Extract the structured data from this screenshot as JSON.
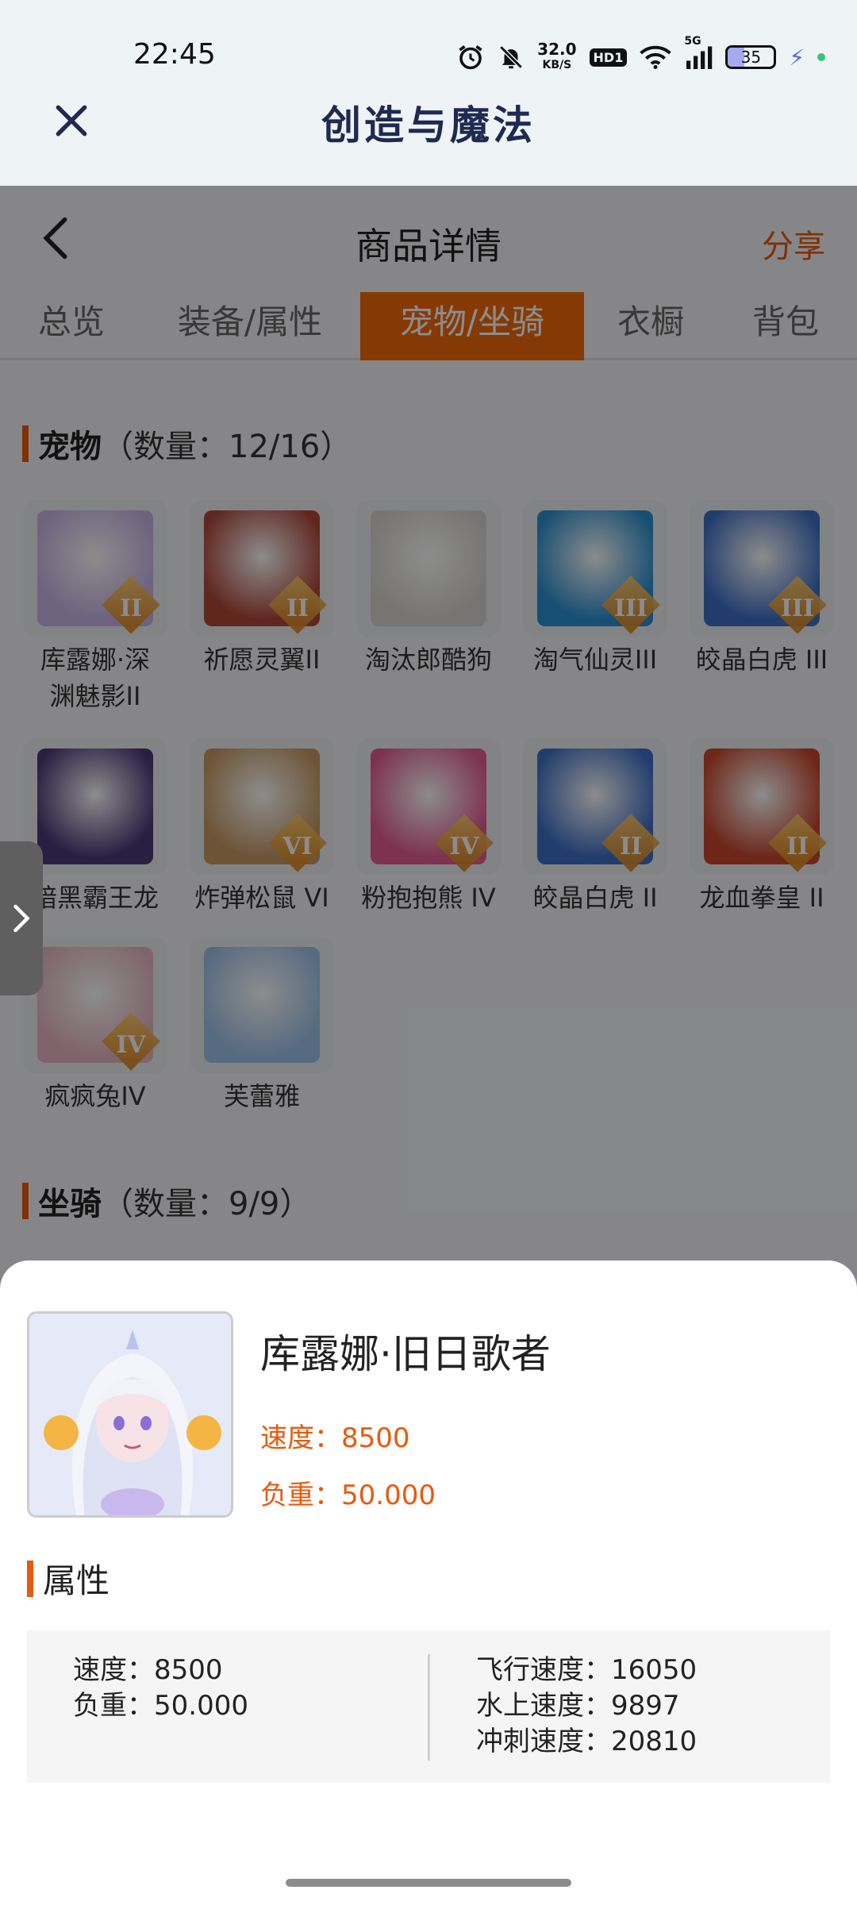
{
  "status_bar": {
    "time": "22:45",
    "net_speed_value": "32.0",
    "net_speed_unit": "KB/S",
    "hd_label": "HD1",
    "network_label": "5G",
    "battery_level": "35",
    "battery_fraction": 0.35
  },
  "app": {
    "title": "创造与魔法"
  },
  "nav": {
    "title": "商品详情",
    "share": "分享"
  },
  "tabs": [
    {
      "label": "总览",
      "active": false
    },
    {
      "label": "装备/属性",
      "active": false
    },
    {
      "label": "宠物/坐骑",
      "active": true
    },
    {
      "label": "衣橱",
      "active": false
    },
    {
      "label": "背包",
      "active": false
    }
  ],
  "pets_section": {
    "title": "宠物",
    "count": "（数量：12/16）"
  },
  "pets": [
    {
      "name": "库露娜·深渊魅影II",
      "rank": "II",
      "color": "#c9b3e8"
    },
    {
      "name": "祈愿灵翼II",
      "rank": "II",
      "color": "#b0473a"
    },
    {
      "name": "淘汰郎酷狗",
      "rank": "",
      "color": "#d8d6d0"
    },
    {
      "name": "淘气仙灵III",
      "rank": "III",
      "color": "#2a8fd1"
    },
    {
      "name": "皎晶白虎 III",
      "rank": "III",
      "color": "#3d6fc7"
    },
    {
      "name": "暗黑霸王龙",
      "rank": "",
      "color": "#4b3a7a"
    },
    {
      "name": "炸弹松鼠 VI",
      "rank": "VI",
      "color": "#c79a63"
    },
    {
      "name": "粉抱抱熊 IV",
      "rank": "IV",
      "color": "#e45b8e"
    },
    {
      "name": "皎晶白虎 II",
      "rank": "II",
      "color": "#3d6fc7"
    },
    {
      "name": "龙血拳皇 II",
      "rank": "II",
      "color": "#c8452c"
    },
    {
      "name": "疯疯兔IV",
      "rank": "IV",
      "color": "#e8b8c4"
    },
    {
      "name": "芙蕾雅",
      "rank": "",
      "color": "#9fc3ea"
    }
  ],
  "mounts_section": {
    "title": "坐骑",
    "count": "（数量：9/9）"
  },
  "detail": {
    "name": "库露娜·旧日歌者",
    "speed": "速度：8500",
    "load": "负重：50.000",
    "attr_title": "属性",
    "attrs_left": [
      "速度：8500",
      "负重：50.000"
    ],
    "attrs_right": [
      "飞行速度：16050",
      "水上速度：9897",
      "冲刺速度：20810"
    ]
  }
}
